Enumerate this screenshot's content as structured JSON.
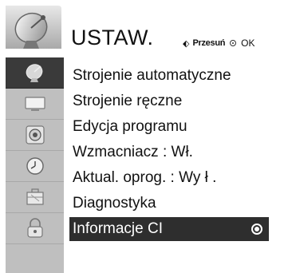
{
  "header": {
    "title": "USTAW.",
    "hint_move_label": "Przesuń",
    "hint_ok_label": "OK",
    "icon": "satellite-dish-icon"
  },
  "sidebar": {
    "items": [
      {
        "icon": "satellite-dish-icon",
        "active": true
      },
      {
        "icon": "monitor-icon",
        "active": false
      },
      {
        "icon": "speaker-icon",
        "active": false
      },
      {
        "icon": "clock-icon",
        "active": false
      },
      {
        "icon": "toolbox-icon",
        "active": false
      },
      {
        "icon": "lock-icon",
        "active": false
      }
    ]
  },
  "menu": {
    "items": [
      {
        "label": "Strojenie automatyczne"
      },
      {
        "label": "Strojenie ręczne"
      },
      {
        "label": "Edycja programu"
      },
      {
        "label": "Wzmacniacz   : Wł."
      },
      {
        "label": "Aktual. oprog.  : Wy ł ."
      },
      {
        "label": "Diagnostyka"
      },
      {
        "label": "Informacje CI",
        "selected": true
      }
    ]
  },
  "colors": {
    "sidebar_bg": "#bfbfbf",
    "active_bg": "#3a3a3a",
    "selected_row_bg": "#2e2e2e"
  }
}
